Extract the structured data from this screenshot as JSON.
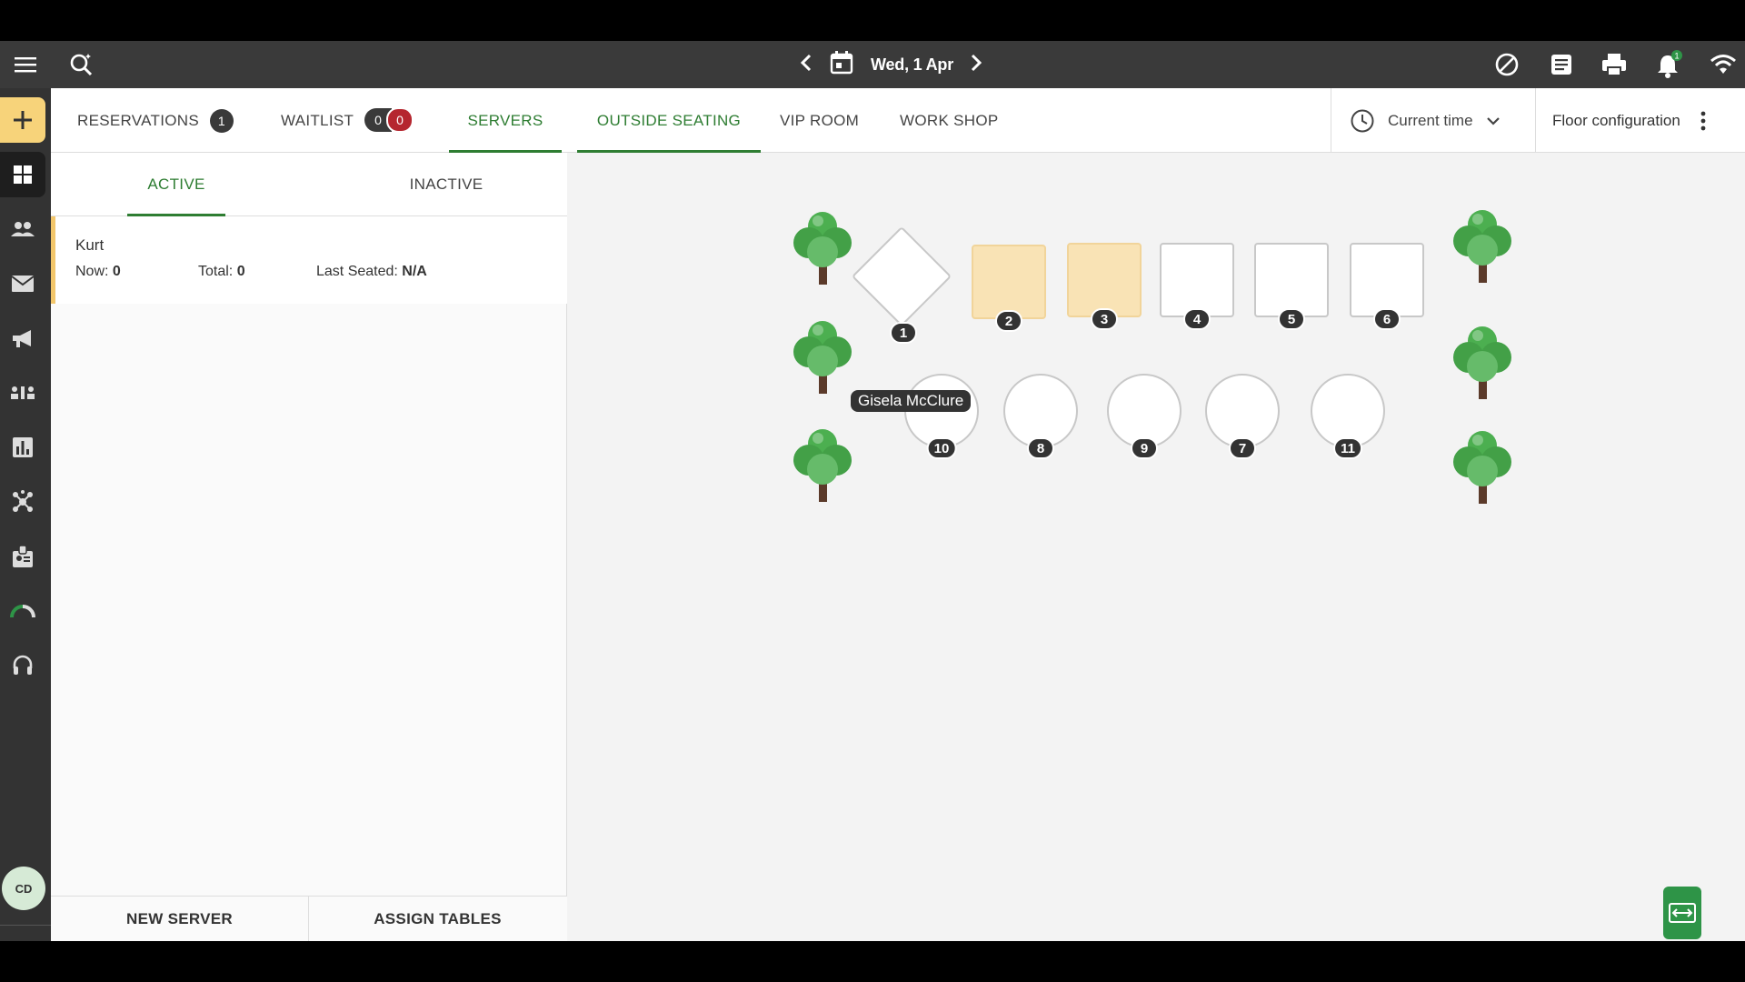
{
  "topbar": {
    "date": "Wed, 1 Apr",
    "notif_count": "1"
  },
  "rail": {
    "avatar_initials": "CD",
    "logo": "eat"
  },
  "left_tabs": [
    {
      "label": "RESERVATIONS",
      "badge": "1"
    },
    {
      "label": "WAITLIST",
      "badge_a": "0",
      "badge_b": "0"
    },
    {
      "label": "SERVERS"
    }
  ],
  "server_tabs": {
    "active": "ACTIVE",
    "inactive": "INACTIVE"
  },
  "server": {
    "name": "Kurt",
    "now_label": "Now:",
    "now": "0",
    "total_label": "Total:",
    "total": "0",
    "last_label": "Last Seated:",
    "last": "N/A"
  },
  "left_bottom": {
    "new_server": "NEW SERVER",
    "assign_tables": "ASSIGN TABLES"
  },
  "room_tabs": [
    "OUTSIDE SEATING",
    "VIP ROOM",
    "WORK SHOP"
  ],
  "time": {
    "label": "Current time"
  },
  "floor": {
    "label": "Floor configuration"
  },
  "tables": {
    "t1": "1",
    "t2": "2",
    "t3": "3",
    "t4": "4",
    "t5": "5",
    "t6": "6",
    "t10": "10",
    "t8": "8",
    "t9": "9",
    "t7": "7",
    "t11": "11"
  },
  "tooltip": "Gisela McClure",
  "colors": {
    "accent": "#2e7d32",
    "busy": "#f9e3b5",
    "topbar": "#3a3a3a",
    "add": "#f7d37a"
  }
}
